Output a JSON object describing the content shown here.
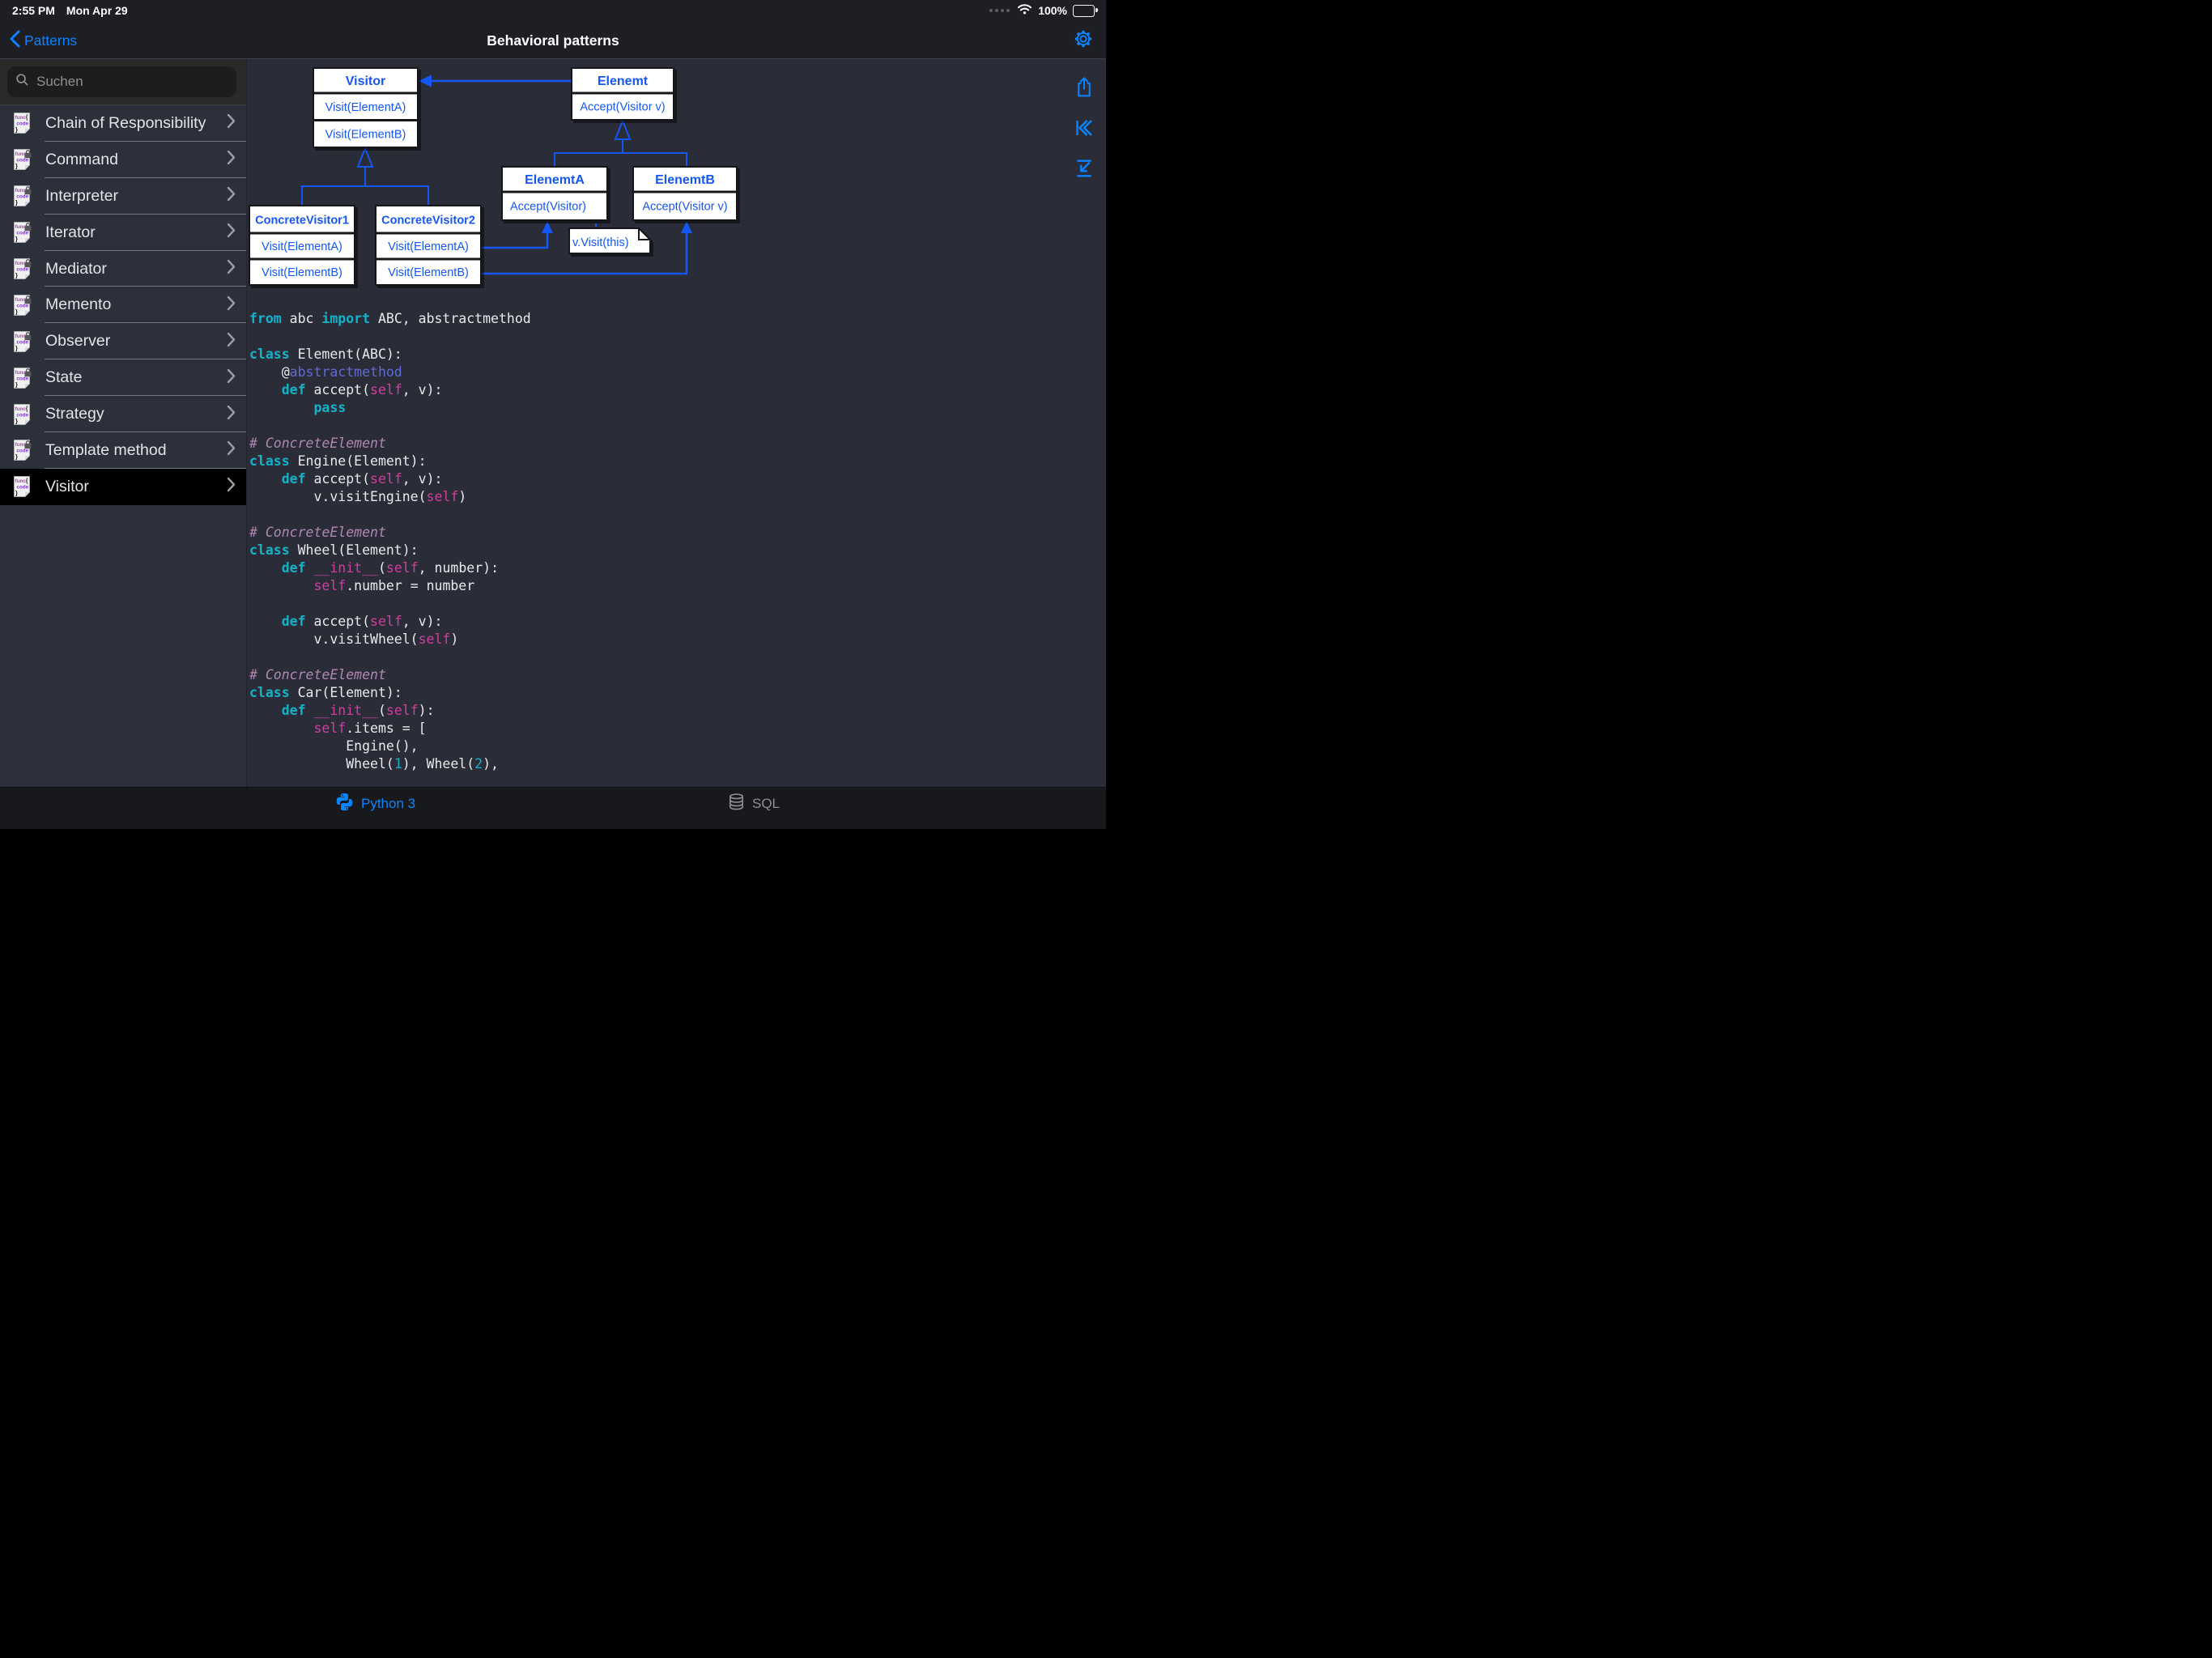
{
  "status_bar": {
    "time": "2:55 PM",
    "date": "Mon Apr 29",
    "battery_percent": "100%"
  },
  "nav_bar": {
    "back_label": "Patterns",
    "title": "Behavioral patterns"
  },
  "search": {
    "placeholder": "Suchen"
  },
  "icon_file_badge": {
    "line1": "func",
    "line2": "code",
    "line3": "}",
    "brace": "{"
  },
  "sidebar": {
    "items": [
      {
        "label": "Chain of Responsibility",
        "locked": false,
        "selected": false
      },
      {
        "label": "Command",
        "locked": true,
        "selected": false
      },
      {
        "label": "Interpreter",
        "locked": true,
        "selected": false
      },
      {
        "label": "Iterator",
        "locked": true,
        "selected": false
      },
      {
        "label": "Mediator",
        "locked": true,
        "selected": false
      },
      {
        "label": "Memento",
        "locked": true,
        "selected": false
      },
      {
        "label": "Observer",
        "locked": true,
        "selected": false
      },
      {
        "label": "State",
        "locked": true,
        "selected": false
      },
      {
        "label": "Strategy",
        "locked": false,
        "selected": false
      },
      {
        "label": "Template method",
        "locked": true,
        "selected": false
      },
      {
        "label": "Visitor",
        "locked": false,
        "selected": true
      }
    ]
  },
  "diagram": {
    "accent": "#1557F2",
    "classes": [
      {
        "id": "visitor",
        "title": "Visitor",
        "methods": [
          "Visit(ElementA)",
          "Visit(ElementB)"
        ]
      },
      {
        "id": "element",
        "title": "Elenemt",
        "methods": [
          "Accept(Visitor v)"
        ]
      },
      {
        "id": "cv1",
        "title": "ConcreteVisitor1",
        "methods": [
          "Visit(ElementA)",
          "Visit(ElementB)"
        ]
      },
      {
        "id": "cv2",
        "title": "ConcreteVisitor2",
        "methods": [
          "Visit(ElementA)",
          "Visit(ElementB)"
        ]
      },
      {
        "id": "elementA",
        "title": "ElenemtA",
        "methods": [
          "Accept(Visitor)"
        ]
      },
      {
        "id": "elementB",
        "title": "ElenemtB",
        "methods": [
          "Accept(Visitor v)"
        ]
      }
    ],
    "note": "v.Visit(this)"
  },
  "code": {
    "lines": [
      [
        [
          "k",
          "from"
        ],
        [
          "p",
          " abc "
        ],
        [
          "k",
          "import"
        ],
        [
          "p",
          " ABC, abstractmethod"
        ]
      ],
      [],
      [
        [
          "k",
          "class"
        ],
        [
          "p",
          " Element(ABC):"
        ]
      ],
      [
        [
          "p",
          "    @"
        ],
        [
          "d",
          "abstractmethod"
        ]
      ],
      [
        [
          "p",
          "    "
        ],
        [
          "k",
          "def"
        ],
        [
          "p",
          " accept("
        ],
        [
          "s",
          "self"
        ],
        [
          "p",
          ", v):"
        ]
      ],
      [
        [
          "p",
          "        "
        ],
        [
          "k",
          "pass"
        ]
      ],
      [],
      [
        [
          "c",
          "# ConcreteElement"
        ]
      ],
      [
        [
          "k",
          "class"
        ],
        [
          "p",
          " Engine(Element):"
        ]
      ],
      [
        [
          "p",
          "    "
        ],
        [
          "k",
          "def"
        ],
        [
          "p",
          " accept("
        ],
        [
          "s",
          "self"
        ],
        [
          "p",
          ", v):"
        ]
      ],
      [
        [
          "p",
          "        v.visitEngine("
        ],
        [
          "s",
          "self"
        ],
        [
          "p",
          ")"
        ]
      ],
      [],
      [
        [
          "c",
          "# ConcreteElement"
        ]
      ],
      [
        [
          "k",
          "class"
        ],
        [
          "p",
          " Wheel(Element):"
        ]
      ],
      [
        [
          "p",
          "    "
        ],
        [
          "k",
          "def"
        ],
        [
          "p",
          " "
        ],
        [
          "s",
          "__init__"
        ],
        [
          "p",
          "("
        ],
        [
          "s",
          "self"
        ],
        [
          "p",
          ", number):"
        ]
      ],
      [
        [
          "p",
          "        "
        ],
        [
          "s",
          "self"
        ],
        [
          "p",
          ".number = number"
        ]
      ],
      [],
      [
        [
          "p",
          "    "
        ],
        [
          "k",
          "def"
        ],
        [
          "p",
          " accept("
        ],
        [
          "s",
          "self"
        ],
        [
          "p",
          ", v):"
        ]
      ],
      [
        [
          "p",
          "        v.visitWheel("
        ],
        [
          "s",
          "self"
        ],
        [
          "p",
          ")"
        ]
      ],
      [],
      [
        [
          "c",
          "# ConcreteElement"
        ]
      ],
      [
        [
          "k",
          "class"
        ],
        [
          "p",
          " Car(Element):"
        ]
      ],
      [
        [
          "p",
          "    "
        ],
        [
          "k",
          "def"
        ],
        [
          "p",
          " "
        ],
        [
          "s",
          "__init__"
        ],
        [
          "p",
          "("
        ],
        [
          "s",
          "self"
        ],
        [
          "p",
          "):"
        ]
      ],
      [
        [
          "p",
          "        "
        ],
        [
          "s",
          "self"
        ],
        [
          "p",
          ".items = ["
        ]
      ],
      [
        [
          "p",
          "            Engine(),"
        ]
      ],
      [
        [
          "p",
          "            Wheel("
        ],
        [
          "n",
          "1"
        ],
        [
          "p",
          "), Wheel("
        ],
        [
          "n",
          "2"
        ],
        [
          "p",
          "),"
        ]
      ]
    ]
  },
  "tab_bar": {
    "tabs": [
      {
        "label": "Python 3",
        "icon": "python-icon",
        "active": true
      },
      {
        "label": "SQL",
        "icon": "database-icon",
        "active": false
      }
    ]
  },
  "colors": {
    "accent_blue": "#0A84FF",
    "diagram_blue": "#1557F2",
    "selected_row": "#000000",
    "keyword": "#14B2C9",
    "self_token": "#D03F9E",
    "comment": "#B287B2",
    "decorator": "#5E6AD8"
  }
}
